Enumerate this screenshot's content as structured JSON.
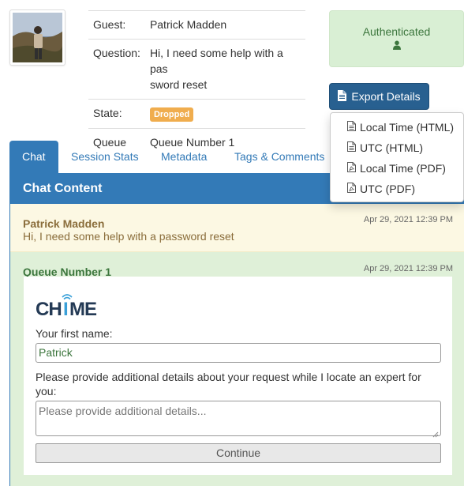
{
  "info": {
    "rows": [
      {
        "key": "Guest:",
        "value": "Patrick Madden"
      },
      {
        "key": "Question:",
        "value": "Hi, I need some help with a pas\nsword reset"
      },
      {
        "key": "State:",
        "badge": "Dropped"
      },
      {
        "key": "Queue",
        "value": "Queue Number 1"
      }
    ]
  },
  "status": {
    "label": "Authenticated",
    "icon": "user-icon",
    "color": "#3c763d"
  },
  "export": {
    "label": "Export Details",
    "icon": "document-icon",
    "menu": [
      {
        "label": "Local Time (HTML)",
        "icon": "file-text-icon"
      },
      {
        "label": "UTC (HTML)",
        "icon": "file-text-icon"
      },
      {
        "label": "Local Time (PDF)",
        "icon": "file-pdf-icon"
      },
      {
        "label": "UTC (PDF)",
        "icon": "file-pdf-icon"
      }
    ]
  },
  "tabs": [
    {
      "label": "Chat",
      "active": true
    },
    {
      "label": "Session Stats",
      "active": false
    },
    {
      "label": "Metadata",
      "active": false
    },
    {
      "label": "Tags & Comments",
      "active": false
    }
  ],
  "panel": {
    "title": "Chat Content",
    "messages": [
      {
        "sender": "Patrick Madden",
        "text": "Hi, I need some help with a password reset",
        "time": "Apr 29, 2021 12:39 PM"
      },
      {
        "sender": "Queue Number 1",
        "time": "Apr 29, 2021 12:39 PM"
      }
    ],
    "form": {
      "logo_text": "CHIME",
      "first_name_label": "Your first name:",
      "first_name_value": "Patrick",
      "details_label": "Please provide additional details about your request while I locate an expert for you:",
      "details_placeholder": "Please provide additional details...",
      "continue_label": "Continue"
    }
  },
  "colors": {
    "primary": "#337ab7",
    "warning": "#f0ad4e",
    "success_bg": "#dff0d8",
    "notice_bg": "#fcf8e3"
  }
}
